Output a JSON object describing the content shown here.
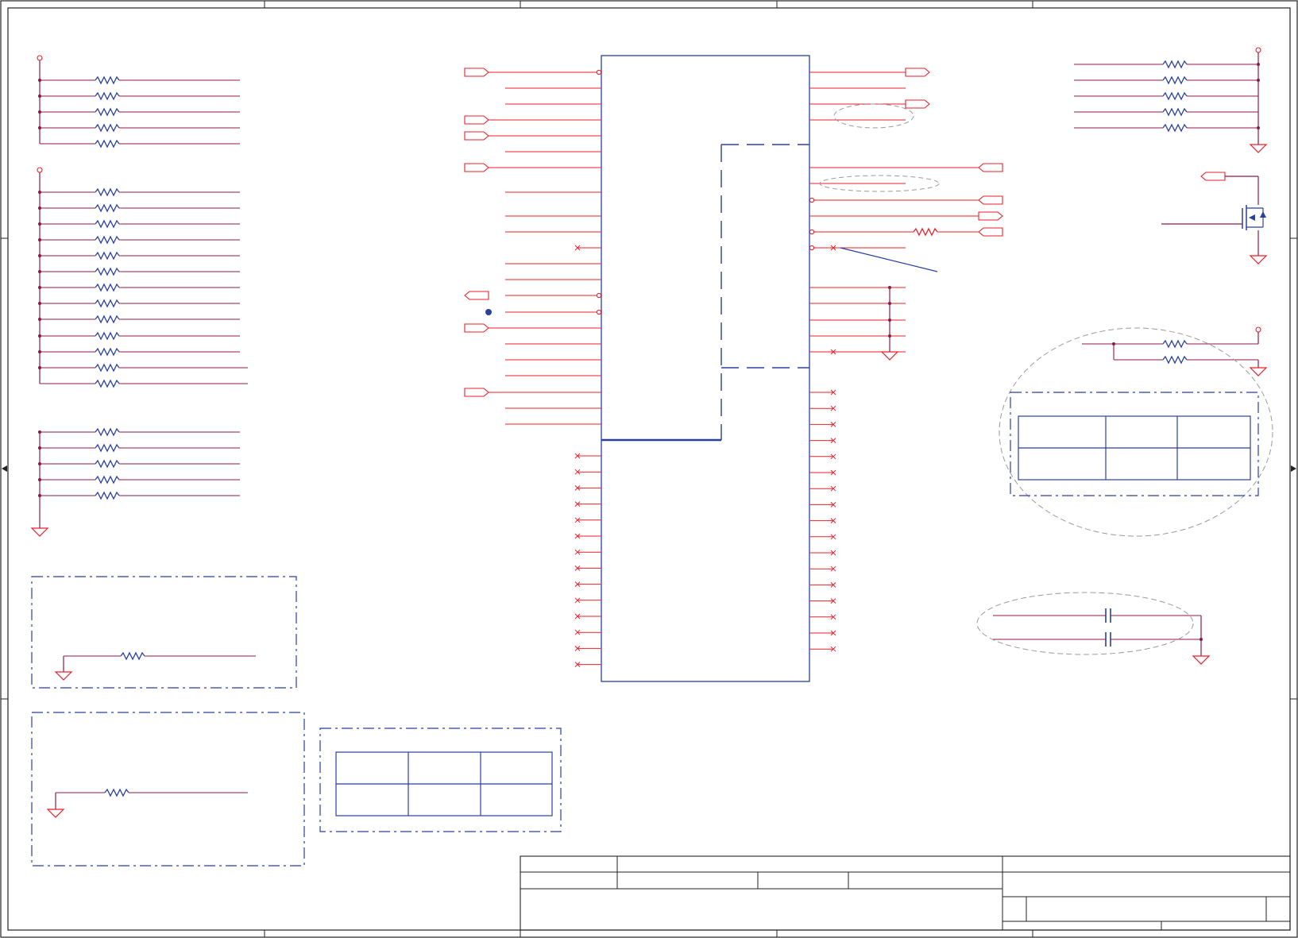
{
  "colors": {
    "wire": "#e8202a",
    "net": "#8b1a4a",
    "component": "#2a3f9e",
    "border": "#222222",
    "annotation": "#9a9a9a",
    "background": "#ffffff"
  },
  "icons": {
    "ground": "ground-icon",
    "resistor": "resistor-icon",
    "capacitor": "capacitor-icon",
    "power_port": "power-port-icon",
    "off_page_connector": "off-page-connector-icon",
    "no_connect": "no-connect-icon",
    "junction": "junction-dot-icon",
    "transistor": "mosfet-icon"
  },
  "sheet": {
    "border_zone_markers": 4,
    "title_block_text": []
  }
}
